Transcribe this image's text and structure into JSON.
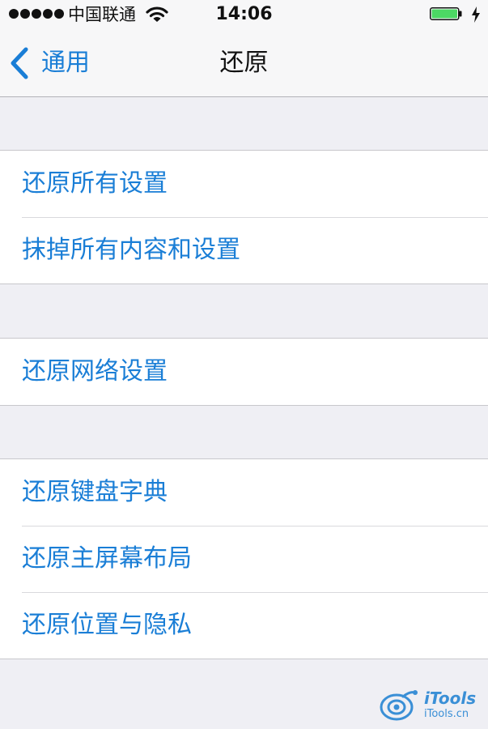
{
  "status_bar": {
    "carrier": "中国联通",
    "time": "14:06",
    "signal_bars": 5,
    "battery_level": 1.0,
    "icons": [
      "signal-dots-icon",
      "wifi-icon",
      "battery-icon",
      "charging-bolt-icon"
    ]
  },
  "nav": {
    "back_label": "通用",
    "title": "还原"
  },
  "groups": [
    {
      "items": [
        {
          "label": "还原所有设置"
        },
        {
          "label": "抹掉所有内容和设置"
        }
      ]
    },
    {
      "items": [
        {
          "label": "还原网络设置"
        }
      ]
    },
    {
      "items": [
        {
          "label": "还原键盘字典"
        },
        {
          "label": "还原主屏幕布局"
        },
        {
          "label": "还原位置与隐私"
        }
      ]
    }
  ],
  "watermark": {
    "brand": "iTools",
    "url": "iTools.cn"
  },
  "colors": {
    "accent": "#1a7ed6",
    "background": "#efeff4",
    "battery": "#4cd964"
  }
}
